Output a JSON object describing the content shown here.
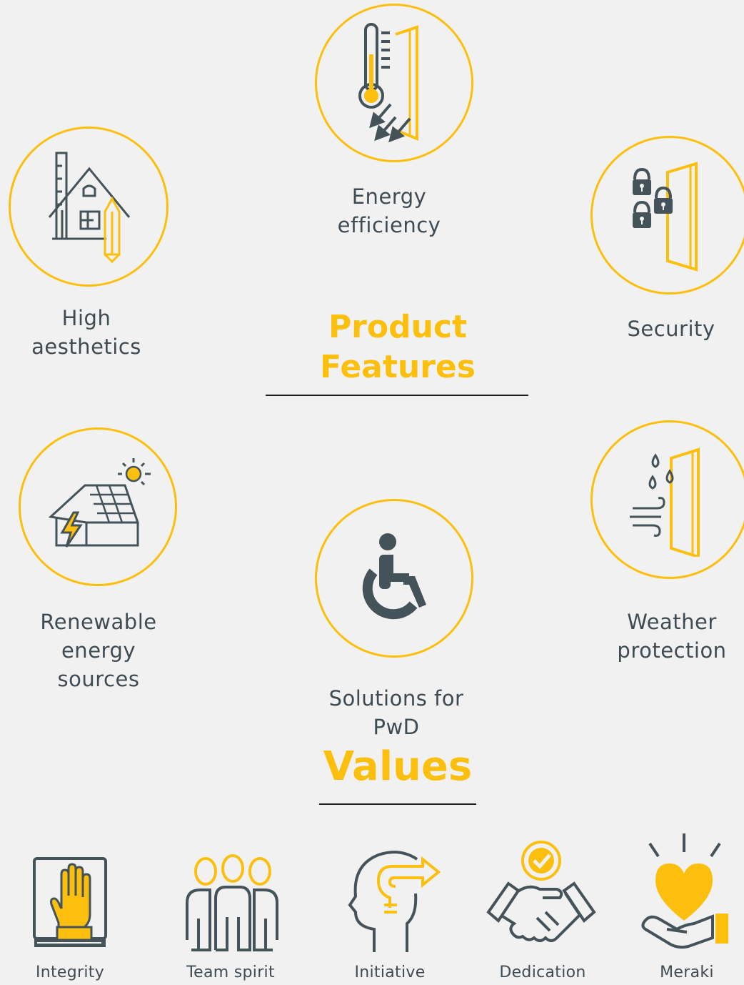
{
  "features_heading": [
    "Product",
    "Features"
  ],
  "values_heading": "Values",
  "features": {
    "energy": [
      "Energy",
      "efficiency"
    ],
    "aesthetics": [
      "High",
      "aesthetics"
    ],
    "security": [
      "Security"
    ],
    "renewable": [
      "Renewable energy",
      "sources"
    ],
    "weather": [
      "Weather",
      "protection"
    ],
    "pwd": [
      "Solutions for",
      "PwD"
    ]
  },
  "values": [
    "Integrity",
    "Team spirit",
    "Initiative",
    "Dedication",
    "Meraki"
  ],
  "icons": {
    "energy": "thermometer-door-icon",
    "aesthetics": "house-design-icon",
    "security": "padlocks-door-icon",
    "renewable": "solar-house-icon",
    "weather": "rain-wind-door-icon",
    "pwd": "wheelchair-icon",
    "integrity": "hand-book-icon",
    "team": "team-people-icon",
    "initiative": "head-idea-arrow-icon",
    "dedication": "handshake-check-icon",
    "meraki": "heart-hand-icon"
  },
  "colors": {
    "accent": "#fcbf0e",
    "dark": "#44525a",
    "background": "#f1f1f1"
  }
}
